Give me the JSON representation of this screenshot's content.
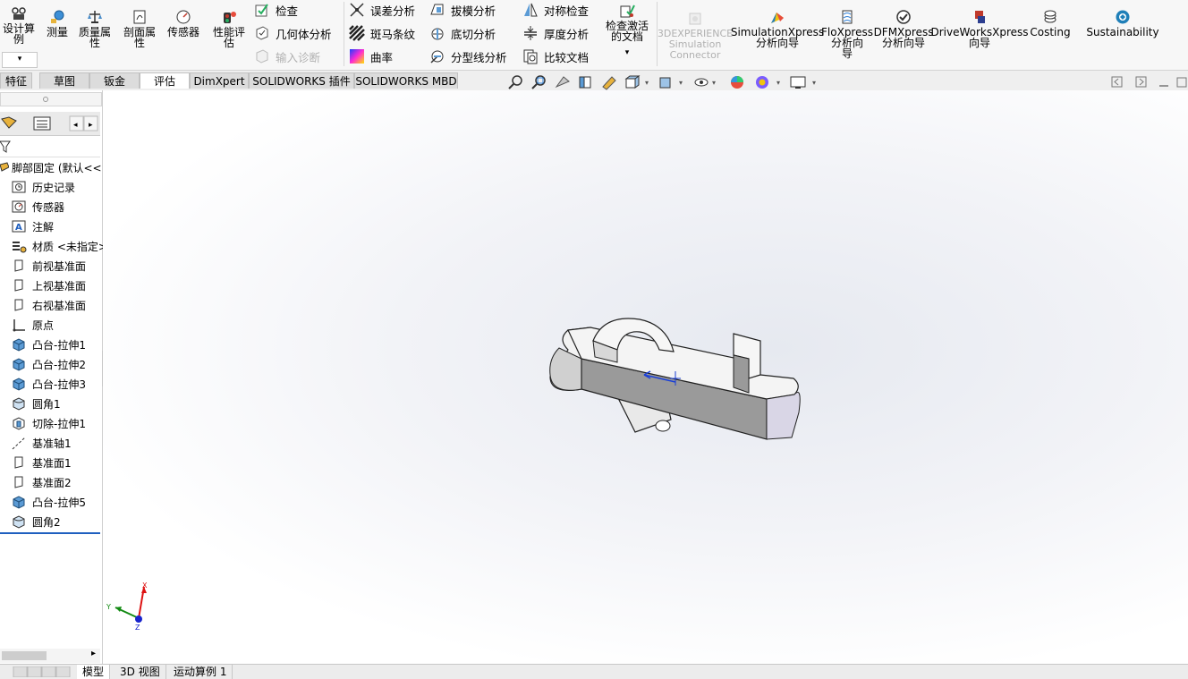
{
  "ribbon": {
    "design_study": "设计算例",
    "big_left": [
      {
        "label": "测量",
        "icon": "measure-icon"
      },
      {
        "label": "质量属\n性",
        "icon": "mass-properties-icon"
      },
      {
        "label": "剖面属\n性",
        "icon": "section-properties-icon"
      },
      {
        "label": "传感器",
        "icon": "sensor-icon"
      },
      {
        "label": "性能评\n估",
        "icon": "performance-icon"
      }
    ],
    "col1": [
      "检查",
      "几何体分析",
      "输入诊断"
    ],
    "col2": [
      "误差分析",
      "斑马条纹",
      "曲率"
    ],
    "col3": [
      "拔模分析",
      "底切分析",
      "分型线分析"
    ],
    "col4": [
      "对称检查",
      "厚度分析",
      "比较文档"
    ],
    "check_active_doc": "检查激活\n的文档",
    "big_right": [
      {
        "label": "3DEXPERIENCE\nSimulation\nConnector",
        "icon": "3dexperience-icon",
        "disabled": true
      },
      {
        "label": "SimulationXpress\n分析向导",
        "icon": "simulationxpress-icon"
      },
      {
        "label": "FloXpress\n分析向\n导",
        "icon": "floxpress-icon"
      },
      {
        "label": "DFMXpress\n分析向导",
        "icon": "dfmxpress-icon"
      },
      {
        "label": "DriveWorksXpress\n向导",
        "icon": "driveworksxpress-icon"
      },
      {
        "label": "Costing",
        "icon": "costing-icon"
      },
      {
        "label": "Sustainability",
        "icon": "sustainability-icon"
      }
    ]
  },
  "tabs": [
    "特征",
    "草图",
    "钣金",
    "评估",
    "DimXpert",
    "SOLIDWORKS 插件",
    "SOLIDWORKS MBD"
  ],
  "active_tab": "评估",
  "feature_tree": {
    "root": "脚部固定 (默认<<",
    "items": [
      {
        "label": "历史记录",
        "icon": "history-icon"
      },
      {
        "label": "传感器",
        "icon": "sensor-icon"
      },
      {
        "label": "注解",
        "icon": "annotation-icon"
      },
      {
        "label": "材质 <未指定>",
        "icon": "material-icon"
      },
      {
        "label": "前视基准面",
        "icon": "plane-icon"
      },
      {
        "label": "上视基准面",
        "icon": "plane-icon"
      },
      {
        "label": "右视基准面",
        "icon": "plane-icon"
      },
      {
        "label": "原点",
        "icon": "origin-icon"
      },
      {
        "label": "凸台-拉伸1",
        "icon": "boss-extrude-icon"
      },
      {
        "label": "凸台-拉伸2",
        "icon": "boss-extrude-icon"
      },
      {
        "label": "凸台-拉伸3",
        "icon": "boss-extrude-icon"
      },
      {
        "label": "圆角1",
        "icon": "fillet-icon"
      },
      {
        "label": "切除-拉伸1",
        "icon": "cut-extrude-icon"
      },
      {
        "label": "基准轴1",
        "icon": "axis-icon"
      },
      {
        "label": "基准面1",
        "icon": "plane-icon"
      },
      {
        "label": "基准面2",
        "icon": "plane-icon"
      },
      {
        "label": "凸台-拉伸5",
        "icon": "boss-extrude-icon"
      },
      {
        "label": "圆角2",
        "icon": "fillet-icon"
      }
    ]
  },
  "triad": {
    "x": "X",
    "y": "Y",
    "z": "Z"
  },
  "bottom_tabs": [
    "模型",
    "3D 视图",
    "运动算例 1"
  ],
  "colors": {
    "accent": "#1f5fbf",
    "part_face": "#9a9a9a",
    "part_light": "#f4f4f4"
  }
}
